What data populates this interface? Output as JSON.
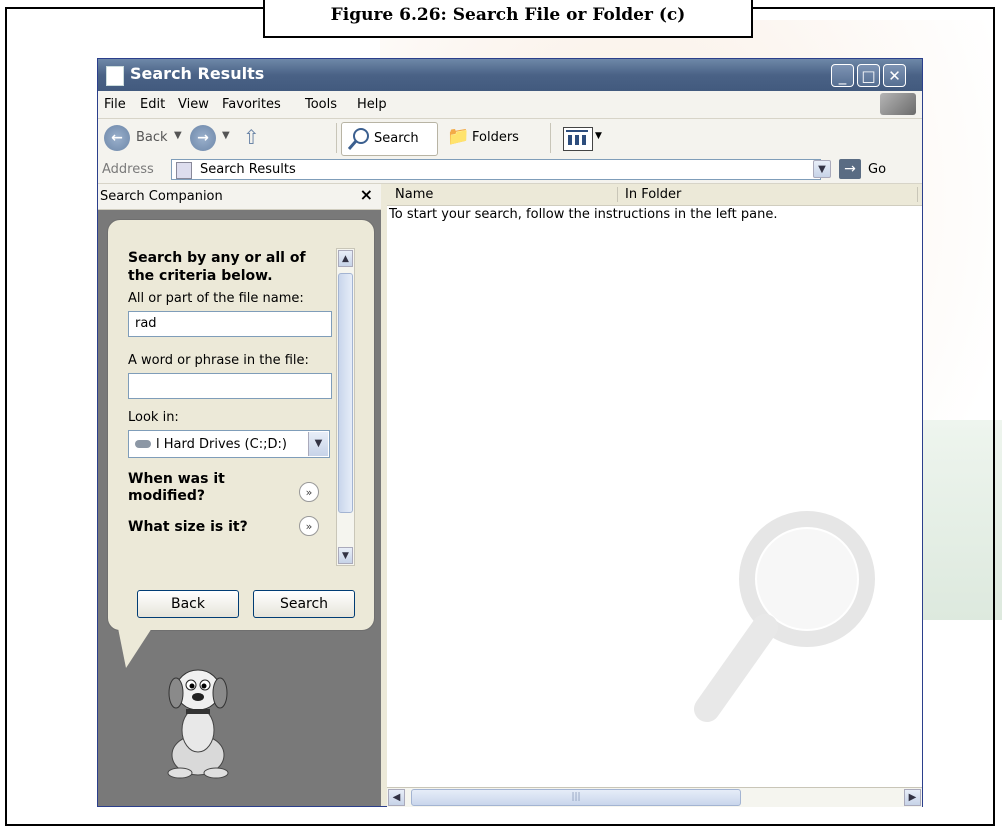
{
  "figure_caption": "Figure 6.26: Search File or Folder (c)",
  "window": {
    "title": "Search Results",
    "controls": {
      "minimize": "_",
      "maximize": "□",
      "close": "✕"
    }
  },
  "menu": [
    "File",
    "Edit",
    "View",
    "Favorites",
    "Tools",
    "Help"
  ],
  "toolbar": {
    "back": "Back",
    "search": "Search",
    "folders": "Folders"
  },
  "address": {
    "label": "Address",
    "value": "Search Results",
    "go": "Go"
  },
  "left_pane": {
    "title": "Search Companion",
    "close": "×",
    "heading": "Search by any or all of the criteria below.",
    "file_name_label": "All or part of the file name:",
    "file_name_value": "rad",
    "phrase_label": "A word or phrase in the file:",
    "phrase_value": "",
    "look_in_label": "Look in:",
    "look_in_value": "l Hard Drives (C:;D:)",
    "q_modified": "When was it modified?",
    "q_size": "What size is it?",
    "back_button": "Back",
    "search_button": "Search"
  },
  "results": {
    "columns": [
      "Name",
      "In Folder"
    ],
    "message": "To start your search, follow the instructions in the left pane."
  },
  "colors": {
    "titlebar": "#4a6286",
    "window_bg": "#ECE9D8",
    "assistant_bg": "#797979"
  }
}
